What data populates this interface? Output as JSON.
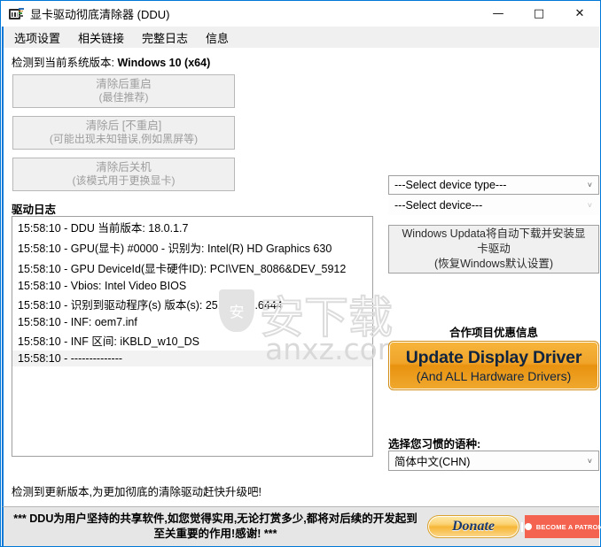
{
  "window": {
    "title": "显卡驱动彻底清除器 (DDU)",
    "icon": "ddu-app-icon",
    "controls": {
      "minimize": "—",
      "maximize": "□",
      "close": "✕"
    }
  },
  "menubar": {
    "items": [
      {
        "label": "选项设置"
      },
      {
        "label": "相关链接"
      },
      {
        "label": "完整日志"
      },
      {
        "label": "信息"
      }
    ]
  },
  "main": {
    "system_version_prefix": "检测到当前系统版本: ",
    "system_version_value": "Windows 10 (x64)",
    "buttons": [
      {
        "line1": "清除后重启",
        "line2": "(最佳推荐)"
      },
      {
        "line1": "清除后 [不重启]",
        "line2": "(可能出现未知错误,例如黑屏等)"
      },
      {
        "line1": "清除后关机",
        "line2": "(该模式用于更换显卡)"
      }
    ],
    "log_label": "驱动日志",
    "log_lines": [
      "15:58:10 - DDU 当前版本: 18.0.1.7",
      "15:58:10 - GPU(显卡) #0000 - 识别为: Intel(R) HD Graphics 630",
      "15:58:10 - GPU DeviceId(显卡硬件ID): PCI\\VEN_8086&DEV_5912",
      "15:58:10 - Vbios: Intel Video BIOS",
      "15:58:10 - 识别到驱动程序(s) 版本(s): 25.20.100.6444",
      "15:58:10 - INF: oem7.inf",
      "15:58:10 - INF 区间: iKBLD_w10_DS",
      "15:58:10 - --------------"
    ],
    "watermark_text": "anxz.com",
    "watermark_cjk": "安下载"
  },
  "right_panel": {
    "device_type_value": "---Select device type---",
    "device_value": "---Select device---",
    "windows_update_note_line1": "Windows Updata将自动下载并安装显",
    "windows_update_note_line2": "卡驱动",
    "windows_update_note_line3": "(恢复Windows默认设置)",
    "promo_label": "合作项目优惠信息",
    "promo_line1": "Update Display Driver",
    "promo_line2": "(And ALL Hardware Drivers)",
    "language_label": "选择您习惯的语种:",
    "language_value": "简体中文(CHN)",
    "chevron": "˅"
  },
  "footer": {
    "update_notice": "检测到更新版本,为更加彻底的清除驱动赶快升级吧!",
    "donate_text": "*** DDU为用户坚持的共享软件,如您觉得实用,无论打赏多少,都将对后续的开发起到至关重要的作用!感谢! ***",
    "donate_button": "Donate",
    "patron_button": "BECOME A PATRON"
  },
  "colors": {
    "accent_blue": "#0078d7",
    "promo_orange": "#f0a42a",
    "promo_text": "#10243f",
    "patron_red": "#f4634f",
    "disabled_text": "#9d9d9d"
  }
}
